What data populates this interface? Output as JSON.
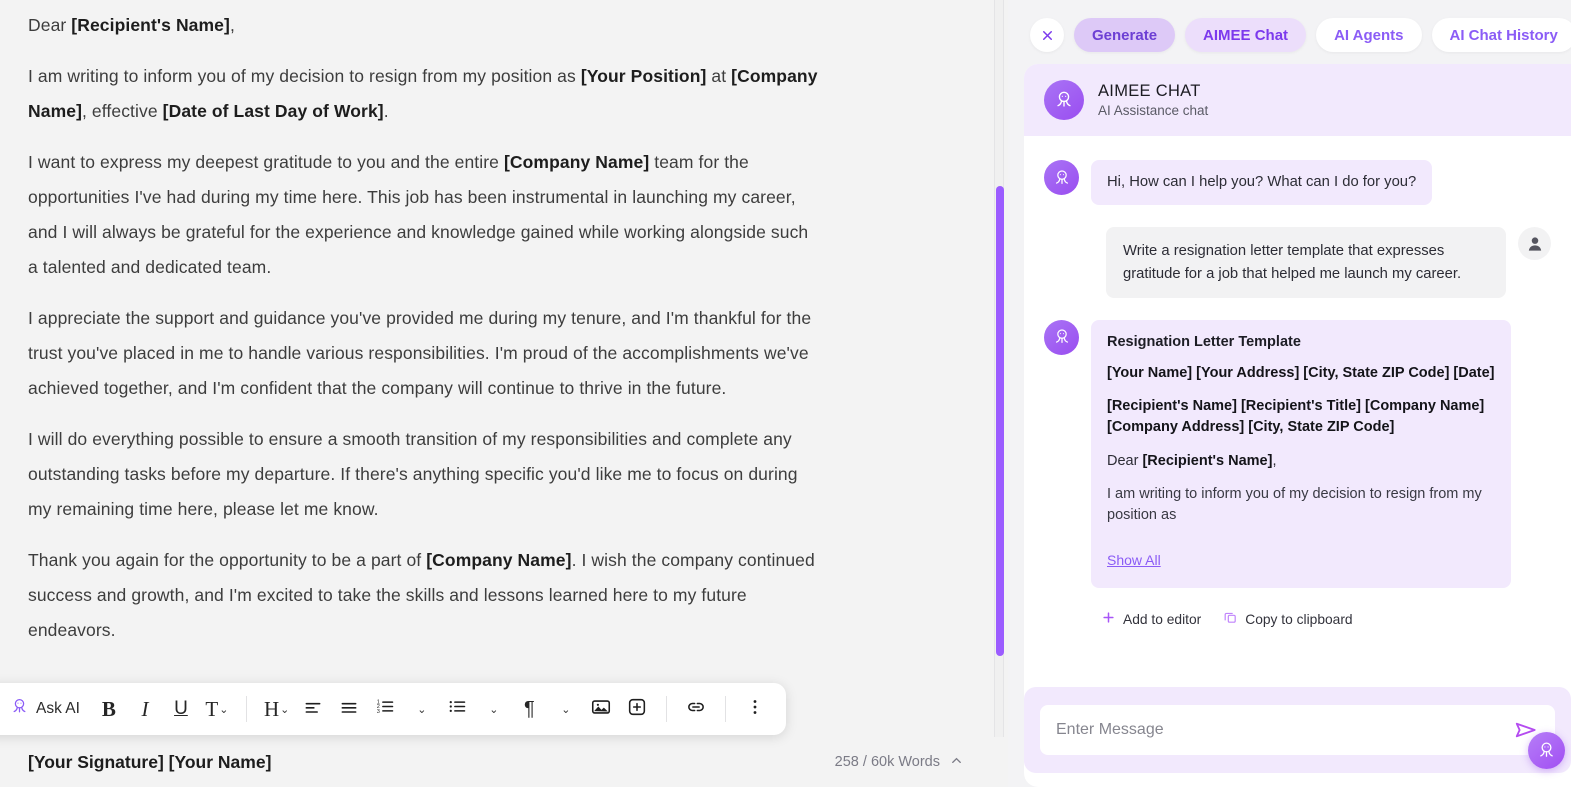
{
  "document": {
    "paragraphs": [
      [
        {
          "t": "Dear ",
          "b": false
        },
        {
          "t": "[Recipient's Name]",
          "b": true
        },
        {
          "t": ",",
          "b": false
        }
      ],
      [
        {
          "t": "I am writing to inform you of my decision to resign from my position as ",
          "b": false
        },
        {
          "t": "[Your Position]",
          "b": true
        },
        {
          "t": " at ",
          "b": false
        },
        {
          "t": "[Company Name]",
          "b": true
        },
        {
          "t": ", effective ",
          "b": false
        },
        {
          "t": "[Date of Last Day of Work]",
          "b": true
        },
        {
          "t": ".",
          "b": false
        }
      ],
      [
        {
          "t": "I want to express my deepest gratitude to you and the entire ",
          "b": false
        },
        {
          "t": "[Company Name]",
          "b": true
        },
        {
          "t": " team for the opportunities I've had during my time here. This job has been instrumental in launching my career, and I will always be grateful for the experience and knowledge gained while working alongside such a talented and dedicated team.",
          "b": false
        }
      ],
      [
        {
          "t": "I appreciate the support and guidance you've provided me during my tenure, and I'm thankful for the trust you've placed in me to handle various responsibilities. I'm proud of the accomplishments we've achieved together, and I'm confident that the company will continue to thrive in the future.",
          "b": false
        }
      ],
      [
        {
          "t": "I will do everything possible to ensure a smooth transition of my responsibilities and complete any outstanding tasks before my departure. If there's anything specific you'd like me to focus on during my remaining time here, please let me know.",
          "b": false
        }
      ],
      [
        {
          "t": "Thank you again for the opportunity to be a part of ",
          "b": false
        },
        {
          "t": "[Company Name]",
          "b": true
        },
        {
          "t": ". I wish the company continued success and growth, and I'm excited to take the skills and lessons learned here to my future endeavors.",
          "b": false
        }
      ]
    ],
    "signature": "[Your Signature] [Your Name]",
    "word_count": "258 / 60k Words"
  },
  "toolbar": {
    "ask_ai_label": "Ask AI",
    "bold_label": "B",
    "italic_label": "I",
    "underline_label": "U",
    "text_style_label": "T",
    "heading_label": "H",
    "caret": "⌄"
  },
  "chat": {
    "close_label": "✕",
    "tabs": [
      {
        "label": "Generate",
        "style": "generate"
      },
      {
        "label": "AIMEE Chat",
        "style": "active"
      },
      {
        "label": "AI Agents",
        "style": "plain"
      },
      {
        "label": "AI Chat History",
        "style": "plain"
      }
    ],
    "header": {
      "title": "AIMEE CHAT",
      "subtitle": "AI Assistance chat"
    },
    "greeting": "Hi, How can I help you? What can I do for you?",
    "user_message": "Write a resignation letter template that expresses gratitude for a job that helped me launch my career.",
    "answer": {
      "title": "Resignation Letter Template",
      "lines": [
        [
          {
            "t": "[Your Name] [Your Address] [City, State ZIP Code] [Date]",
            "b": true
          }
        ],
        [
          {
            "t": "[Recipient's Name] [Recipient's Title] [Company Name] [Company Address] [City, State ZIP Code]",
            "b": true
          }
        ],
        [
          {
            "t": "Dear ",
            "b": false
          },
          {
            "t": "[Recipient's Name]",
            "b": true
          },
          {
            "t": ",",
            "b": false
          }
        ],
        [
          {
            "t": "I am writing to inform you of my decision to resign from my position as",
            "b": false
          }
        ]
      ],
      "show_all_label": "Show All"
    },
    "actions": [
      {
        "label": "Add to editor",
        "icon": "plus-icon"
      },
      {
        "label": "Copy to clipboard",
        "icon": "copy-icon"
      }
    ],
    "composer": {
      "placeholder": "Enter Message",
      "value": ""
    }
  },
  "colors": {
    "accent": "#8b5cf6",
    "accent_deep": "#6d3fd4",
    "bubble_bg": "#f2e9fd",
    "scrollbar": "#9b5cff"
  }
}
